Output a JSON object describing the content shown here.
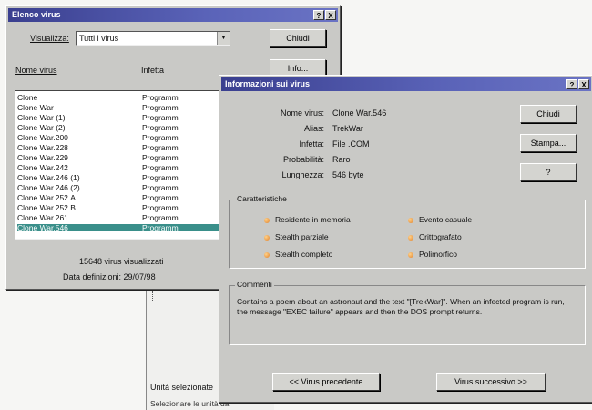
{
  "list_window": {
    "title": "Elenco virus",
    "title_buttons": [
      "?",
      "X"
    ],
    "view_label": "Visualizza:",
    "view_value": "Tutti i virus",
    "close_button": "Chiudi",
    "info_button": "Info...",
    "col_name": "Nome virus",
    "col_infects": "Infetta",
    "rows": [
      {
        "name": "Clone",
        "infects": "Programmi"
      },
      {
        "name": "Clone War",
        "infects": "Programmi"
      },
      {
        "name": "Clone War (1)",
        "infects": "Programmi"
      },
      {
        "name": "Clone War (2)",
        "infects": "Programmi"
      },
      {
        "name": "Clone War.200",
        "infects": "Programmi"
      },
      {
        "name": "Clone War.228",
        "infects": "Programmi"
      },
      {
        "name": "Clone War.229",
        "infects": "Programmi"
      },
      {
        "name": "Clone War.242",
        "infects": "Programmi"
      },
      {
        "name": "Clone War.246 (1)",
        "infects": "Programmi"
      },
      {
        "name": "Clone War.246 (2)",
        "infects": "Programmi"
      },
      {
        "name": "Clone War.252.A",
        "infects": "Programmi"
      },
      {
        "name": "Clone War.252.B",
        "infects": "Programmi"
      },
      {
        "name": "Clone War.261",
        "infects": "Programmi"
      },
      {
        "name": "Clone War.546",
        "infects": "Programmi",
        "selected": true
      }
    ],
    "count_text": "15648 virus visualizzati",
    "date_text": "Data definizioni: 29/07/98"
  },
  "behind_window": {
    "selected_units": "Unità selezionate",
    "hint": "Selezionare le unità da"
  },
  "info_window": {
    "title": "Informazioni sui virus",
    "title_buttons": [
      "?",
      "X"
    ],
    "fields": [
      {
        "label": "Nome virus:",
        "value": "Clone War.546"
      },
      {
        "label": "Alias:",
        "value": "TrekWar"
      },
      {
        "label": "Infetta:",
        "value": "File .COM"
      },
      {
        "label": "Probabilità:",
        "value": "Raro"
      },
      {
        "label": "Lunghezza:",
        "value": "546 byte"
      }
    ],
    "close_button": "Chiudi",
    "print_button": "Stampa...",
    "help_button": "?",
    "features_title": "Caratteristiche",
    "features": [
      "Residente in memoria",
      "Evento casuale",
      "Stealth parziale",
      "Crittografato",
      "Stealth completo",
      "Polimorfico"
    ],
    "comments_title": "Commenti",
    "comment": "Contains a poem about an astronaut and the text \"[TrekWar]\". When an infected program is run, the message \"EXEC failure\" appears and then the DOS prompt returns.",
    "prev_button": "<< Virus precedente",
    "next_button": "Virus successivo >>"
  }
}
